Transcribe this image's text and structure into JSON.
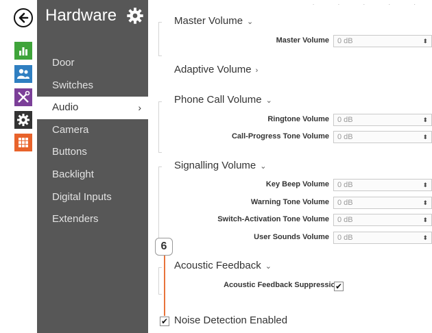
{
  "sidebar": {
    "title": "Hardware",
    "items": [
      {
        "label": "Door"
      },
      {
        "label": "Switches"
      },
      {
        "label": "Audio",
        "chevron": "›"
      },
      {
        "label": "Camera"
      },
      {
        "label": "Buttons"
      },
      {
        "label": "Backlight"
      },
      {
        "label": "Digital Inputs"
      },
      {
        "label": "Extenders"
      }
    ]
  },
  "icons": {
    "back": "arrow-left-icon",
    "status": "bar-chart-icon",
    "users": "users-icon",
    "tools": "tools-icon",
    "settings": "gear-icon",
    "apps": "grid-icon",
    "colors": {
      "status": "#3fa43a",
      "users": "#2f7fc1",
      "tools": "#7b3f98",
      "settings": "#333333",
      "apps": "#e8632b",
      "annotation": "#e8733a"
    }
  },
  "sections": {
    "master": {
      "title": "Master Volume",
      "caret": "⌄",
      "rows": [
        {
          "label": "Master Volume",
          "value": "0 dB"
        }
      ]
    },
    "adaptive": {
      "title": "Adaptive Volume",
      "caret": "›"
    },
    "phone": {
      "title": "Phone Call Volume",
      "caret": "⌄",
      "rows": [
        {
          "label": "Ringtone Volume",
          "value": "0 dB"
        },
        {
          "label": "Call-Progress Tone Volume",
          "value": "0 dB"
        }
      ]
    },
    "signalling": {
      "title": "Signalling Volume",
      "caret": "⌄",
      "rows": [
        {
          "label": "Key Beep Volume",
          "value": "0 dB"
        },
        {
          "label": "Warning Tone Volume",
          "value": "0 dB"
        },
        {
          "label": "Switch-Activation Tone Volume",
          "value": "0 dB"
        },
        {
          "label": "User Sounds Volume",
          "value": "0 dB"
        }
      ]
    },
    "acoustic": {
      "title": "Acoustic Feedback",
      "caret": "⌄",
      "rows": [
        {
          "label": "Acoustic Feedback Suppression",
          "checked": true
        }
      ]
    },
    "noise": {
      "label": "Noise Detection Enabled",
      "checked": true
    }
  },
  "select_arrow": "⬍",
  "check_mark": "✔",
  "annotation": {
    "number": "6"
  }
}
